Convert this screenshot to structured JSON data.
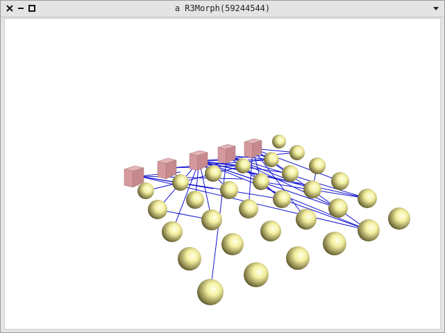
{
  "window": {
    "title": "a R3Morph(59244544)",
    "buttons": [
      "close-icon",
      "minimize-icon",
      "maximize-icon",
      "menu-icon"
    ]
  },
  "scene": {
    "sphere_color": "#f4f0a0",
    "cube_color": "#d4999c",
    "edge_color": "#1010d0"
  }
}
